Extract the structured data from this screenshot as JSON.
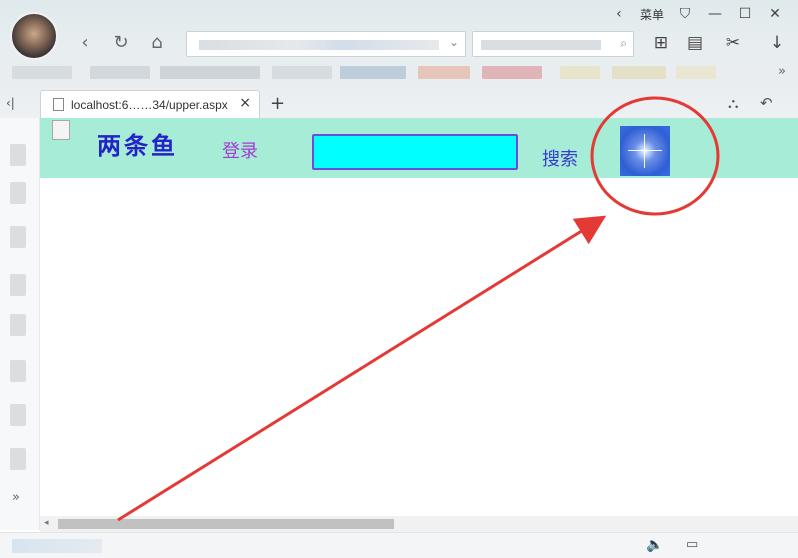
{
  "window": {
    "menu_label": "菜单",
    "minimize_icon": "—",
    "maximize_icon": "☐",
    "close_icon": "✕",
    "chevron_icon": "‹",
    "skin_icon": "⛉"
  },
  "nav": {
    "back_icon": "‹",
    "refresh_icon": "↻",
    "home_icon": "⌂"
  },
  "tools": {
    "apps_icon": "⊞",
    "reader_icon": "▤",
    "cut_icon": "✂",
    "download_icon": "↓",
    "more_icon": "»"
  },
  "tab": {
    "label": "localhost:6……34/upper.aspx",
    "close_icon": "×",
    "new_tab_icon": "+",
    "collapse_icon": "‹|"
  },
  "tab_tools": {
    "tool1_icon": "⛬",
    "undo_icon": "↶"
  },
  "sidebar": {
    "expand_icon": "»"
  },
  "page": {
    "site_title": "两条鱼",
    "login_label": "登录",
    "search_value": "",
    "search_label": "搜索"
  },
  "scrollbar": {
    "left_arrow": "◂"
  },
  "statusbar": {
    "volume_icon": "🔈",
    "second_icon": "▭"
  },
  "colors": {
    "header_band": "#a6ecd6",
    "title": "#2323c8",
    "login": "#a53ad6",
    "search_box": "#00ffff",
    "annotation": "#e53935"
  }
}
